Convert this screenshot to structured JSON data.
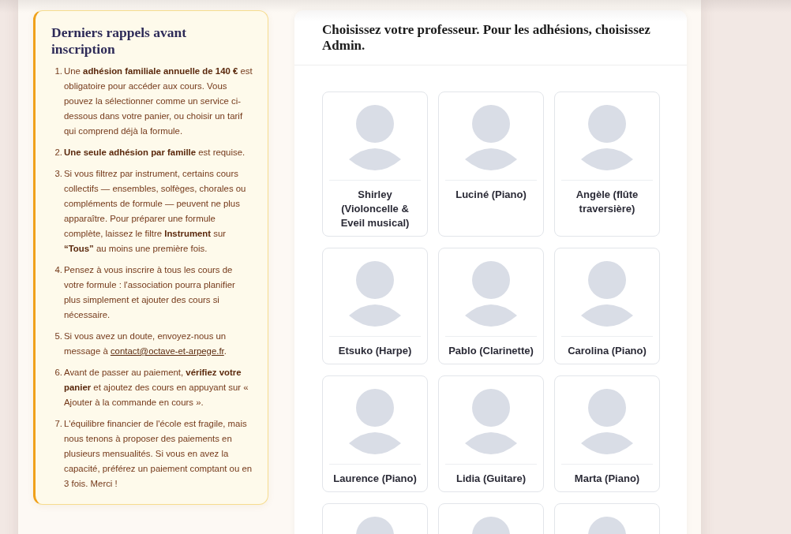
{
  "reminders": {
    "title": "Derniers rappels avant inscription",
    "items": [
      {
        "number": "1.",
        "text": "Une **adhésion familiale annuelle de 140 €** est obligatoire pour accéder aux cours. Vous pouvez la sélectionner comme un service ci-dessous dans votre panier, ou choisir un tarif qui comprend déjà la formule."
      },
      {
        "number": "2.",
        "text": "**Une seule adhésion par famille** est requise."
      },
      {
        "number": "3.",
        "text": "Si vous filtrez par instrument, certains cours collectifs — ensembles, solfèges, chorales ou compléments de formule — peuvent ne plus apparaître. Pour préparer une formule complète, laissez le filtre **Instrument** sur **“Tous”** au moins une première fois."
      },
      {
        "number": "4.",
        "text": "Pensez à vous inscrire à tous les cours de votre formule : l'association pourra planifier plus simplement et ajouter des cours si nécessaire."
      },
      {
        "number": "5.",
        "text": "Si vous avez un doute, envoyez-nous un message à ",
        "link": "contact@octave-et-arpege.fr",
        "text_after": "."
      },
      {
        "number": "6.",
        "text": "Avant de passer au paiement, **vérifiez votre panier** et ajoutez des cours en appuyant sur « Ajouter à la commande en cours »."
      },
      {
        "number": "7.",
        "text": "L'équilibre financier de l'école est fragile, mais nous tenons à proposer des paiements en plusieurs mensualités. Si vous en avez la capacité, préférez un paiement comptant ou en 3 fois. Merci !"
      }
    ]
  },
  "teacher_picker": {
    "title": "Choisissez votre professeur. Pour les adhésions, choisissez Admin.",
    "teachers": [
      {
        "kind": "card",
        "name": "Shirley (Violoncelle & Eveil musical)"
      },
      {
        "kind": "card",
        "name": "Luciné (Piano)"
      },
      {
        "kind": "card",
        "name": "Angèle (flûte traversière)"
      },
      {
        "kind": "card",
        "name": "Etsuko (Harpe)"
      },
      {
        "kind": "card",
        "name": "Pablo (Clarinette)"
      },
      {
        "kind": "card",
        "name": "Carolina (Piano)"
      },
      {
        "kind": "card",
        "name": "Laurence (Piano)"
      },
      {
        "kind": "card",
        "name": "Lidia (Guitare)"
      },
      {
        "kind": "card",
        "name": "Marta (Piano)"
      },
      {
        "kind": "cut_off"
      },
      {
        "kind": "cut_off"
      },
      {
        "kind": "cut_off"
      }
    ]
  }
}
